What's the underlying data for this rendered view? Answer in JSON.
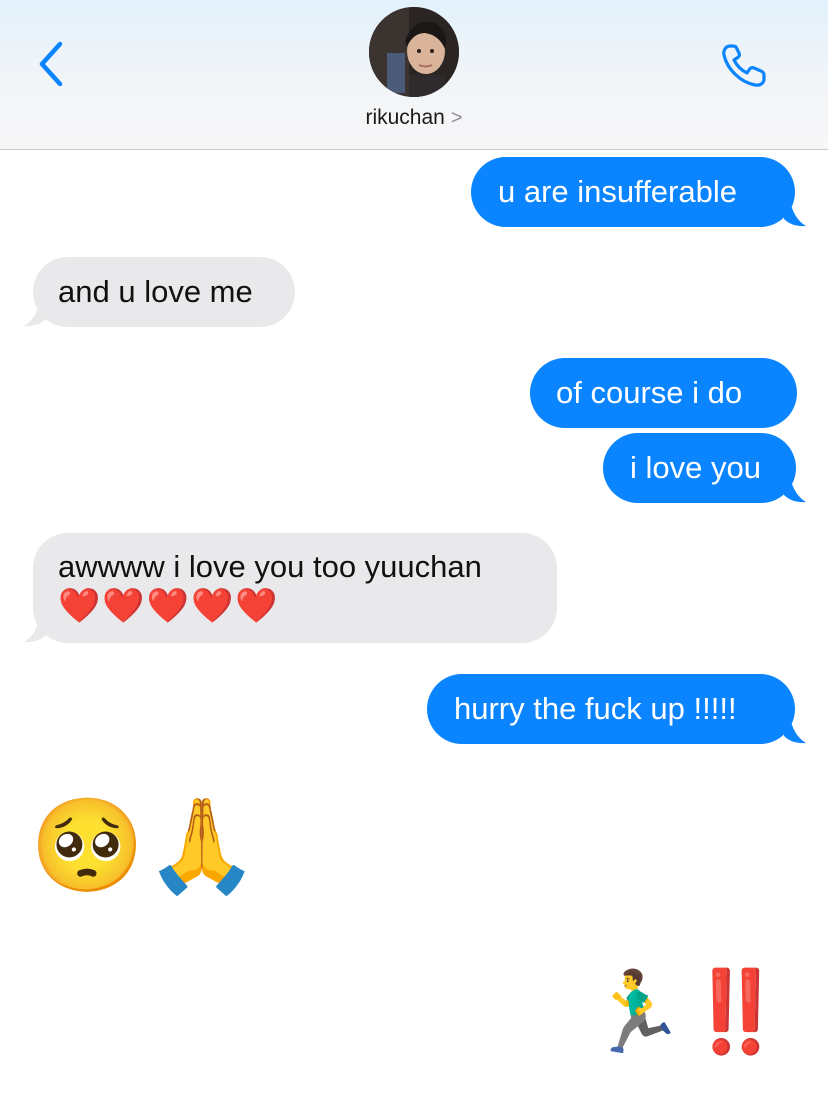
{
  "header": {
    "contact_name": "rikuchan",
    "contact_chevron": ">",
    "back_icon": "chevron-left-icon",
    "call_icon": "phone-icon",
    "accent_color": "#0a84ff"
  },
  "messages": [
    {
      "direction": "outgoing",
      "text": "u are insufferable"
    },
    {
      "direction": "incoming",
      "text": "and u love me"
    },
    {
      "direction": "outgoing",
      "text": "of course i do"
    },
    {
      "direction": "outgoing",
      "text": "i love you"
    },
    {
      "direction": "incoming",
      "text": "awwww i love you too yuuchan",
      "emoji": "❤️❤️❤️❤️❤️"
    },
    {
      "direction": "outgoing",
      "text": "hurry the fuck up !!!!!"
    },
    {
      "direction": "incoming",
      "emoji_only": "🥺🙏"
    },
    {
      "direction": "outgoing",
      "emoji_only": "🏃‍♂️‼️"
    }
  ],
  "colors": {
    "outgoing_bubble": "#0a84ff",
    "incoming_bubble": "#e9e9eb"
  }
}
